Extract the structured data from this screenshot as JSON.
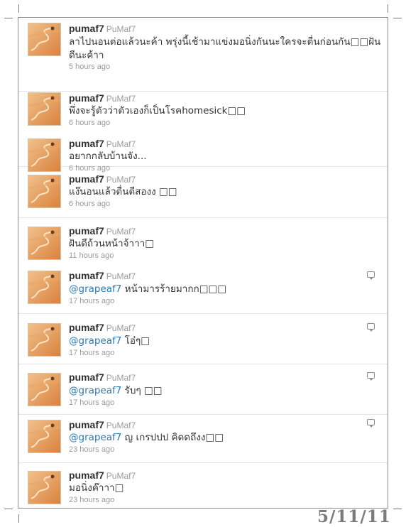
{
  "tweets": [
    {
      "name": "pumaf7",
      "handle": "PuMaf7",
      "mention": "",
      "text": "ลาไปนอนต่อแล้วนะค้า พรุ่งนี้เช้ามาแข่งมอนิ่งกันนะใครจะตื่นก่อนกัน□□ฝันดีนะค้าา",
      "time": "5 hours ago",
      "reply": false
    },
    {
      "name": "pumaf7",
      "handle": "PuMaf7",
      "mention": "",
      "text": "พึ่งจะรู้ตัวว่าตัวเองก็เป็นโรคhomesick□□",
      "time": "6 hours ago",
      "reply": false
    },
    {
      "name": "pumaf7",
      "handle": "PuMaf7",
      "mention": "",
      "text": "อยากกลับบ้านจัง...",
      "time": "6 hours ago",
      "reply": false
    },
    {
      "name": "pumaf7",
      "handle": "PuMaf7",
      "mention": "",
      "text": "แง๊นอนแล้วตื่นตีสองง □□",
      "time": "6 hours ago",
      "reply": false
    },
    {
      "name": "pumaf7",
      "handle": "PuMaf7",
      "mention": "",
      "text": "ฝันดีถ้วนหน้าจ้าาา□",
      "time": "11 hours ago",
      "reply": false
    },
    {
      "name": "pumaf7",
      "handle": "PuMaf7",
      "mention": "@grapeaf7",
      "text": " หน้ามารร้ายมากก□□□",
      "time": "17 hours ago",
      "reply": true
    },
    {
      "name": "pumaf7",
      "handle": "PuMaf7",
      "mention": "@grapeaf7",
      "text": " โอ๋ๆ□",
      "time": "17 hours ago",
      "reply": true
    },
    {
      "name": "pumaf7",
      "handle": "PuMaf7",
      "mention": "@grapeaf7",
      "text": " รับๆ □□",
      "time": "17 hours ago",
      "reply": true
    },
    {
      "name": "pumaf7",
      "handle": "PuMaf7",
      "mention": "@grapeaf7",
      "text": " ญ เกรปปป คิดดถึงง□□",
      "time": "23 hours ago",
      "reply": true
    },
    {
      "name": "pumaf7",
      "handle": "PuMaf7",
      "mention": "",
      "text": "มอนิ่งค๊าาา□",
      "time": "23 hours ago",
      "reply": false
    }
  ],
  "stamp": "5/11/11",
  "colors": {
    "link": "#2a7ab8",
    "meta": "#9a9a9a",
    "avatar": "#e8a05a"
  }
}
